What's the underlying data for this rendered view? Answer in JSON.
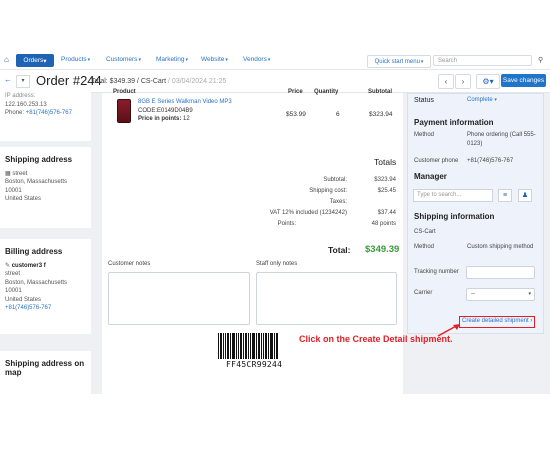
{
  "nav": {
    "orders": "Orders",
    "products": "Products",
    "customers": "Customers",
    "marketing": "Marketing",
    "website": "Website",
    "vendors": "Vendors",
    "quick_start": "Quick start menu",
    "search_placeholder": "Search"
  },
  "header": {
    "title": "Order #244",
    "total_label": "Total: $349.39 / CS-Cart",
    "date": "/ 03/04/2024 21:25",
    "save": "Save changes"
  },
  "left": {
    "customer_partial": {
      "ip_label": "IP address:",
      "ip": "122.160.253.13",
      "phone_label": "Phone:",
      "phone": "+81(746)576-767"
    },
    "shipping": {
      "title": "Shipping address",
      "street": "street",
      "city": "Boston, Massachusetts",
      "zip": "10001",
      "country": "United States"
    },
    "billing": {
      "title": "Billing address",
      "name": "customer3 f",
      "street": "street",
      "city": "Boston, Massachusetts",
      "zip": "10001",
      "country": "United States",
      "phone": "+81(746)576-767"
    },
    "map": {
      "title": "Shipping address on map"
    }
  },
  "products": {
    "columns": [
      "Product",
      "Price",
      "Quantity",
      "Subtotal"
    ],
    "item": {
      "name": "8GB E Series Walkman Video MP3",
      "code": "CODE:E0149D04B9",
      "points_label": "Price in points:",
      "points": "12",
      "price": "$53.99",
      "quantity": "6",
      "subtotal": "$323.94"
    }
  },
  "totals": {
    "title": "Totals",
    "subtotal_label": "Subtotal:",
    "subtotal": "$323.94",
    "shipping_label": "Shipping cost:",
    "shipping": "$25.45",
    "taxes_label": "Taxes:",
    "vat_label": "VAT 12% included (1234242)",
    "vat": "$37.44",
    "points_label": "Points:",
    "points": "48 points",
    "total_label": "Total:",
    "total": "$349.39"
  },
  "notes": {
    "customer": "Customer notes",
    "staff": "Staff only notes"
  },
  "barcode": {
    "text": "FF45CR99244"
  },
  "right": {
    "status_label": "Status",
    "status": "Complete",
    "payment_title": "Payment information",
    "method_label": "Method",
    "method": "Phone ordering (Call 555-0123)",
    "customer_phone_label": "Customer phone",
    "customer_phone": "+81(746)576-767",
    "manager_title": "Manager",
    "manager_placeholder": "Type to search...",
    "shipping_title": "Shipping information",
    "shipping_vendor": "CS-Cart",
    "ship_method_label": "Method",
    "ship_method": "Custom shipping method",
    "tracking_label": "Tracking number",
    "carrier_label": "Carrier",
    "carrier_value": "--",
    "create_link": "Create detailed shipment"
  },
  "annotation": "Click on the Create Detail shipment.",
  "colors": {
    "accent": "#1f63b4",
    "link": "#2a73c5",
    "total_green": "#3a9a3a",
    "annotation_red": "#e21f26"
  }
}
